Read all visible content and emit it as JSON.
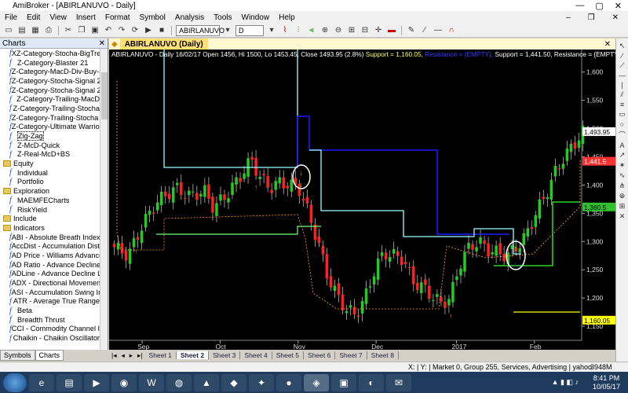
{
  "window": {
    "title": "AmiBroker - [ABIRLANUVO - Daily]"
  },
  "menu": [
    "File",
    "Edit",
    "View",
    "Insert",
    "Format",
    "Symbol",
    "Analysis",
    "Tools",
    "Window",
    "Help"
  ],
  "toolbar": {
    "symbol": "ABIRLANUVO",
    "interval": "D"
  },
  "charts_panel": {
    "title": "Charts",
    "items": [
      {
        "type": "formula",
        "label": "XZ-Category-Stocha-BigTrend"
      },
      {
        "type": "formula",
        "label": "Z-Category-Blaster 21"
      },
      {
        "type": "formula",
        "label": "Z-Category-MacD-Div-Buy-Sel"
      },
      {
        "type": "formula",
        "label": "Z-Category-Stocha-Signal 2"
      },
      {
        "type": "formula",
        "label": "Z-Category-Stocha-Signal 2 1"
      },
      {
        "type": "formula",
        "label": "Z-Category-Trailing-MacD"
      },
      {
        "type": "formula",
        "label": "Z-Category-Trailing-Stocha"
      },
      {
        "type": "formula",
        "label": "Z-Category-Trailing-Stocha 2"
      },
      {
        "type": "formula",
        "label": "Z-Category-Ultimate Warrior 1"
      },
      {
        "type": "formula",
        "label": "Zig-Zag",
        "selected": true
      },
      {
        "type": "formula",
        "label": "Z-McD-Quick"
      },
      {
        "type": "formula",
        "label": "Z-Real-McD+BS"
      },
      {
        "type": "folder",
        "label": "Equity"
      },
      {
        "type": "formula",
        "label": "Individual"
      },
      {
        "type": "formula",
        "label": "Portfolio"
      },
      {
        "type": "folder",
        "label": "Exploration"
      },
      {
        "type": "formula",
        "label": "MAEMFECharts"
      },
      {
        "type": "formula",
        "label": "RiskYield"
      },
      {
        "type": "folder",
        "label": "Include"
      },
      {
        "type": "folder",
        "label": "Indicators"
      },
      {
        "type": "formula",
        "label": "ABI - Absolute Breath Index"
      },
      {
        "type": "formula",
        "label": "AccDist - Accumulation Distrib"
      },
      {
        "type": "formula",
        "label": "AD Price - Williams Advance D"
      },
      {
        "type": "formula",
        "label": "AD Ratio - Advance Decline Ra"
      },
      {
        "type": "formula",
        "label": "ADLine - Advance Decline Line"
      },
      {
        "type": "formula",
        "label": "ADX - Directional Movement In"
      },
      {
        "type": "formula",
        "label": "ASI - Accumulation Swing Inde"
      },
      {
        "type": "formula",
        "label": "ATR - Average True Range"
      },
      {
        "type": "formula",
        "label": "Beta"
      },
      {
        "type": "formula",
        "label": "Breadth Thrust"
      },
      {
        "type": "formula",
        "label": "CCI - Commodity Channel Ind"
      },
      {
        "type": "formula",
        "label": "Chaikin - Chaikin Oscillator"
      }
    ],
    "tabs": [
      "Symbols",
      "Charts"
    ]
  },
  "chart_tab": {
    "label": "ABIRLANUVO (Daily)"
  },
  "chart_data": {
    "type": "candlestick",
    "header": "ABIRLANUVO - Daily 16/02/17 Open 1456, Hi 1500, Lo 1453.45, Close 1493.95 (2.8%)",
    "header_support1": "Support = 1,160.05,",
    "header_resistance1": "Resistance = {EMPTY},",
    "header_support2": "Support = 1,441.50,",
    "header_resistance2": "Resistance = {EMPTY},",
    "header_tail": "(",
    "ylim": [
      1125,
      1640
    ],
    "yticks": [
      1150,
      1200,
      1250,
      1300,
      1350,
      1400,
      1450,
      1500,
      1550,
      1600
    ],
    "ytick_labels": [
      "1,150",
      "1,200",
      "1,250",
      "1,300",
      "1,350",
      "1,400",
      "1,450",
      "1,500",
      "1,550",
      "1,600"
    ],
    "months": [
      {
        "label": "Sep",
        "x": 0.07
      },
      {
        "label": "Oct",
        "x": 0.235
      },
      {
        "label": "Nov",
        "x": 0.4
      },
      {
        "label": "Dec",
        "x": 0.565
      },
      {
        "label": "2017",
        "x": 0.735
      },
      {
        "label": "Feb",
        "x": 0.9
      }
    ],
    "price_labels": [
      {
        "value": 1493.95,
        "text": "1,493.95",
        "bg": "#ffffff",
        "fg": "#000000"
      },
      {
        "value": 1441.5,
        "text": "1,441.5",
        "bg": "#ff3030",
        "fg": "#ffffff"
      },
      {
        "value": 1360.5,
        "text": "1,360.5",
        "bg": "#30c030",
        "fg": "#000000"
      },
      {
        "value": 1160.05,
        "text": "1,160.05",
        "bg": "#ffff00",
        "fg": "#000000"
      }
    ],
    "colors": {
      "up": "#22cc22",
      "down": "#ff2020",
      "bg": "#000000"
    }
  },
  "sheets": [
    "Sheet 1",
    "Sheet 2",
    "Sheet 3",
    "Sheet 4",
    "Sheet 5",
    "Sheet 6",
    "Sheet 7",
    "Sheet 8"
  ],
  "active_sheet": "Sheet 2",
  "status": {
    "text": "X:  |  Y:  |  Market 0, Group 255, Services, Advertising  |  yahoo",
    "mem": "3948M"
  },
  "taskbar": {
    "time": "8:41 PM",
    "date": "10/05/17"
  }
}
